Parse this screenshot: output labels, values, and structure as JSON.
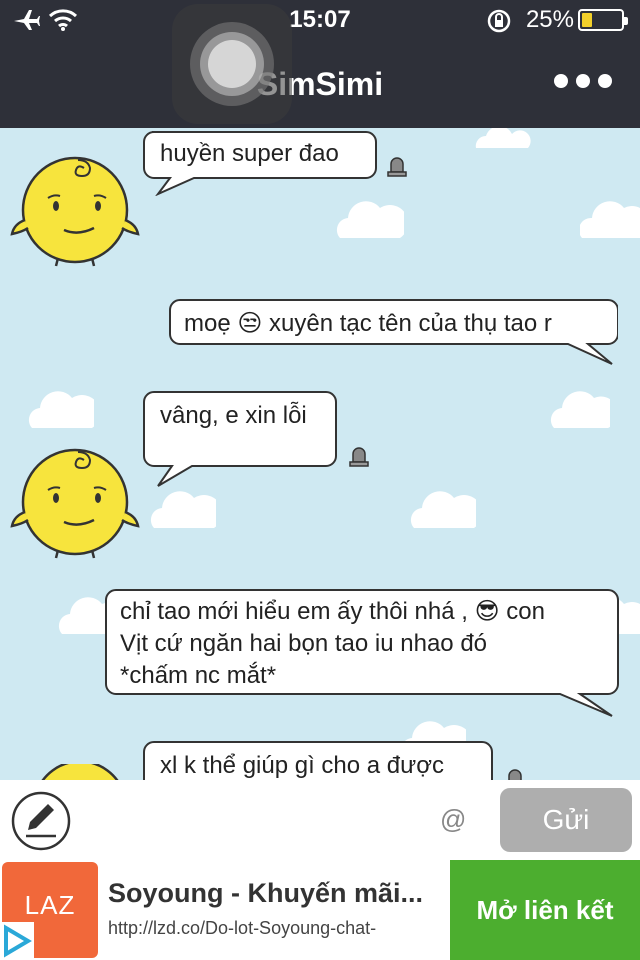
{
  "status_bar": {
    "time": "15:07",
    "battery_percent": "25%",
    "battery_level": 0.25
  },
  "header": {
    "title": "SimSimi"
  },
  "messages": [
    {
      "sender": "simsimi",
      "text": "huyền super đao"
    },
    {
      "sender": "user",
      "text": "moẹ 😒 xuyên tạc tên của thụ tao r"
    },
    {
      "sender": "simsimi",
      "text": "vâng, e xin lỗi"
    },
    {
      "sender": "user",
      "text": "chỉ tao mới hiểu em ấy thôi nhá , 😎 con\nVịt cứ ngăn hai bọn tao iu nhao đó\n*chấm nc mắt*"
    },
    {
      "sender": "simsimi",
      "text": "xl k thể giúp gì cho a được"
    }
  ],
  "composer": {
    "placeholder": "",
    "at_label": "@",
    "send_label": "Gửi"
  },
  "ad": {
    "logo_text": "LAZ",
    "title": "Soyoung - Khuyến mãi...",
    "url": "http://lzd.co/Do-lot-Soyoung-chat-",
    "cta_label": "Mở liên kết"
  },
  "colors": {
    "bar_bg": "#2e3039",
    "chat_bg": "#cfe9f2",
    "simsimi_yellow": "#f7e43d",
    "send_button": "#aeaeae",
    "cta_green": "#4cae2f",
    "lazada_orange": "#f1683a"
  }
}
